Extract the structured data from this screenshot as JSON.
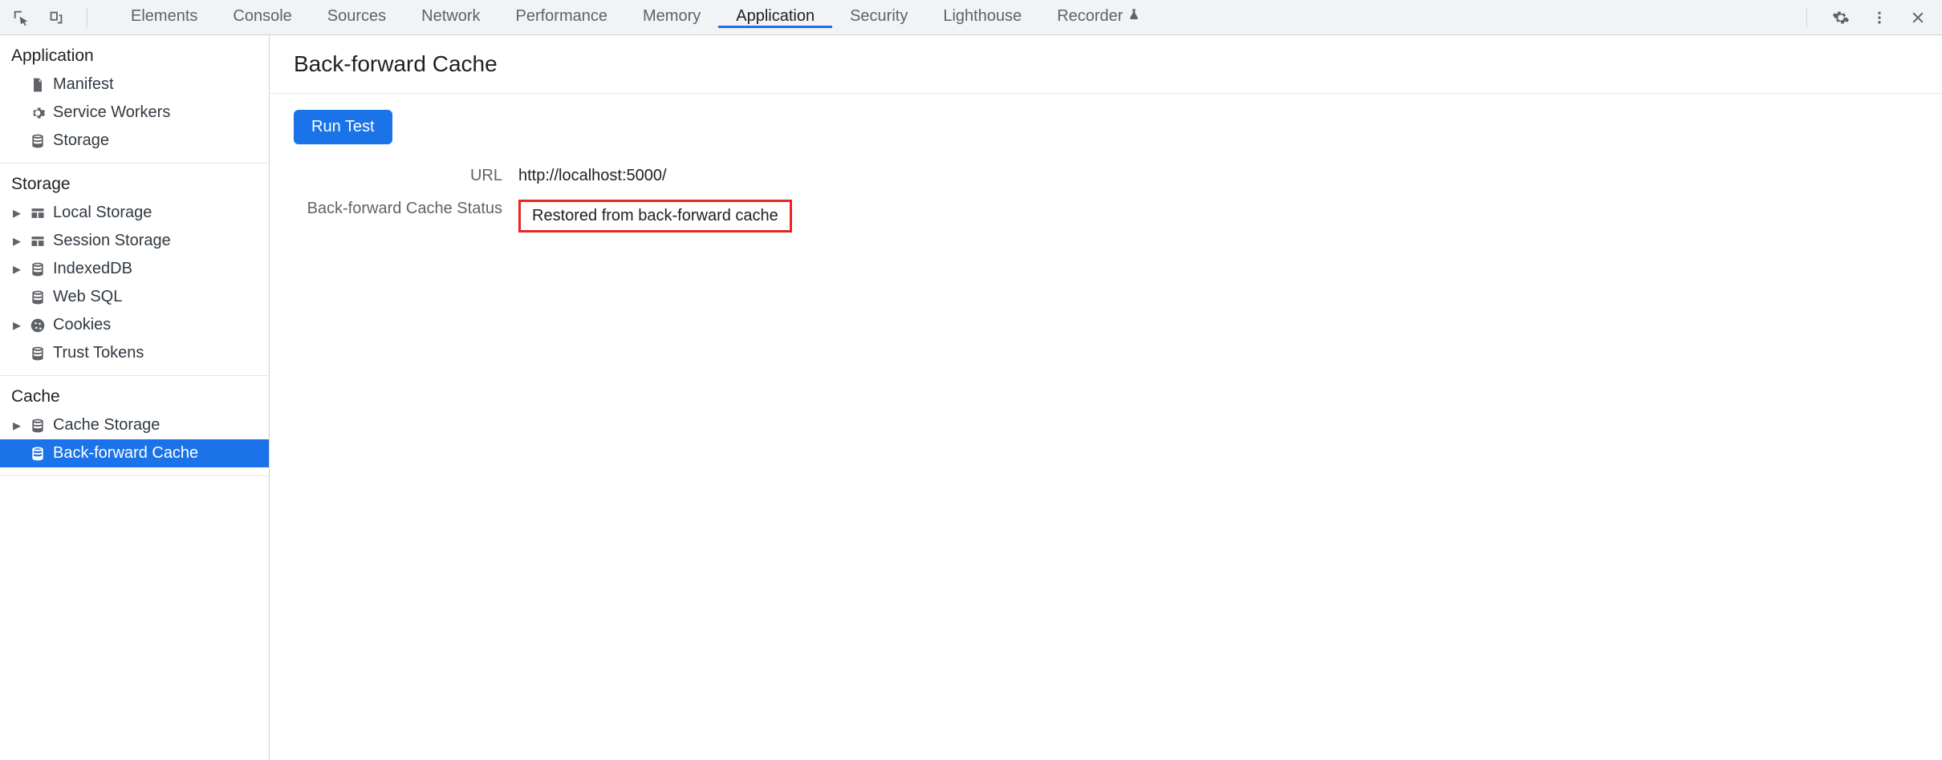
{
  "tabs": [
    "Elements",
    "Console",
    "Sources",
    "Network",
    "Performance",
    "Memory",
    "Application",
    "Security",
    "Lighthouse",
    "Recorder"
  ],
  "active_tab_index": 6,
  "recorder_has_beaker": true,
  "sidebar": {
    "groups": [
      {
        "title": "Application",
        "items": [
          {
            "label": "Manifest",
            "icon": "file",
            "expandable": false
          },
          {
            "label": "Service Workers",
            "icon": "gear",
            "expandable": false
          },
          {
            "label": "Storage",
            "icon": "db",
            "expandable": false
          }
        ]
      },
      {
        "title": "Storage",
        "items": [
          {
            "label": "Local Storage",
            "icon": "table",
            "expandable": true
          },
          {
            "label": "Session Storage",
            "icon": "table",
            "expandable": true
          },
          {
            "label": "IndexedDB",
            "icon": "db",
            "expandable": true
          },
          {
            "label": "Web SQL",
            "icon": "db",
            "expandable": false
          },
          {
            "label": "Cookies",
            "icon": "cookie",
            "expandable": true
          },
          {
            "label": "Trust Tokens",
            "icon": "db",
            "expandable": false
          }
        ]
      },
      {
        "title": "Cache",
        "items": [
          {
            "label": "Cache Storage",
            "icon": "db",
            "expandable": true,
            "selected": false
          },
          {
            "label": "Back-forward Cache",
            "icon": "db",
            "expandable": false,
            "selected": true
          }
        ]
      }
    ]
  },
  "main": {
    "title": "Back-forward Cache",
    "run_button": "Run Test",
    "url_label": "URL",
    "url_value": "http://localhost:5000/",
    "status_label": "Back-forward Cache Status",
    "status_value": "Restored from back-forward cache"
  }
}
